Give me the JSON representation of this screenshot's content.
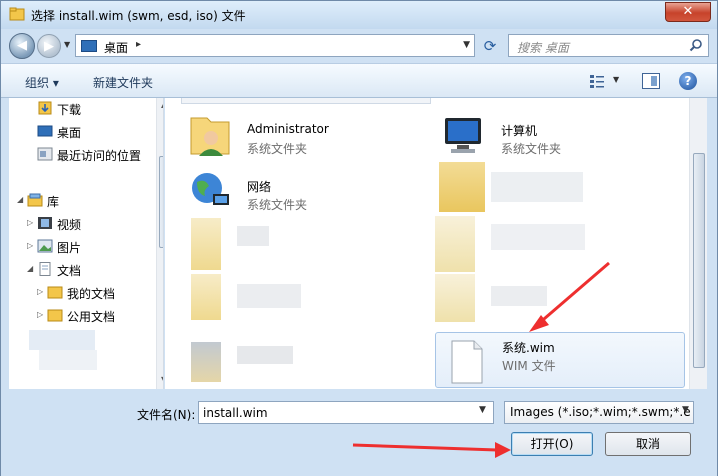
{
  "window": {
    "title": "选择 install.wim (swm, esd, iso) 文件",
    "close_glyph": "✕"
  },
  "address": {
    "location": "桌面",
    "separator": "▸",
    "search_placeholder": "搜索 桌面"
  },
  "toolbar": {
    "organize": "组织 ▾",
    "new_folder": "新建文件夹",
    "help": "?"
  },
  "nav": {
    "items": [
      {
        "label": "下载",
        "icon": "downloads-icon"
      },
      {
        "label": "桌面",
        "icon": "desktop-icon"
      },
      {
        "label": "最近访问的位置",
        "icon": "recent-places-icon"
      },
      {
        "label": "库",
        "icon": "library-icon"
      },
      {
        "label": "视频",
        "icon": "videos-icon"
      },
      {
        "label": "图片",
        "icon": "pictures-icon"
      },
      {
        "label": "文档",
        "icon": "documents-icon"
      },
      {
        "label": "我的文档",
        "icon": "folder-icon"
      },
      {
        "label": "公用文档",
        "icon": "folder-icon"
      }
    ]
  },
  "files": [
    {
      "name": "Administrator",
      "type": "系统文件夹",
      "icon": "user-folder-icon"
    },
    {
      "name": "计算机",
      "type": "系统文件夹",
      "icon": "computer-icon"
    },
    {
      "name": "网络",
      "type": "系统文件夹",
      "icon": "network-icon"
    },
    {
      "name": "系统.wim",
      "type": "WIM 文件",
      "icon": "file-icon"
    }
  ],
  "bottom": {
    "filename_label": "文件名(N):",
    "filename_value": "install.wim",
    "filetype_value": "Images (*.iso;*.wim;*.swm;*.e",
    "open_label": "打开(O)",
    "cancel_label": "取消"
  },
  "colors": {
    "accent": "#2f6fb8",
    "arrow": "#ee2f2f"
  }
}
